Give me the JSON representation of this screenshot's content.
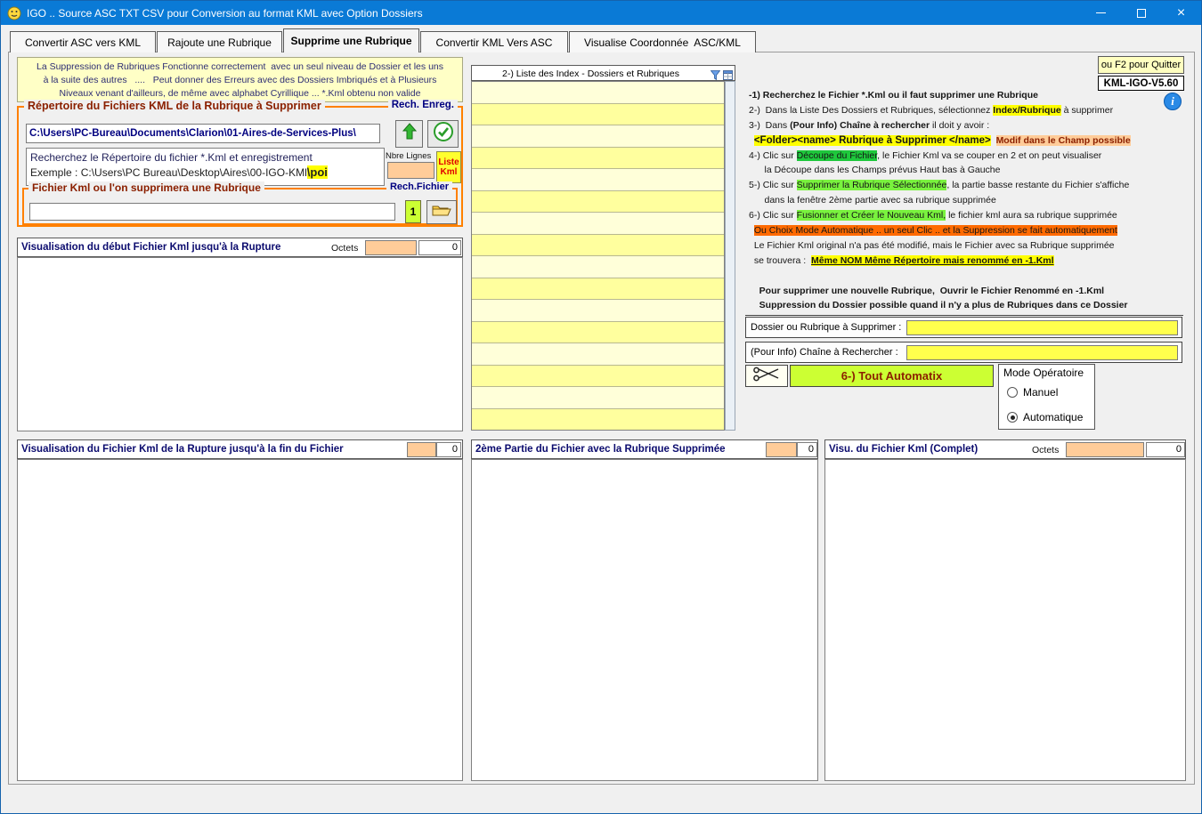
{
  "colors": {
    "titlebar": "#0a7ad6",
    "group_border": "#ff8000",
    "highlight_yellow": "#ffff00",
    "highlight_green": "#79f23e",
    "highlight_orange": "#ff6a00",
    "field_orange": "#ffcc99",
    "field_yellow": "#ffff4d",
    "auto_button": "#ccff33"
  },
  "window": {
    "title": "IGO .. Source ASC TXT CSV pour Conversion au format KML avec Option Dossiers"
  },
  "tabs": [
    {
      "label": "Convertir ASC vers KML",
      "active": false
    },
    {
      "label": "Rajoute une Rubrique",
      "active": false
    },
    {
      "label": "Supprime une Rubrique",
      "active": true
    },
    {
      "label": "Convertir KML Vers ASC",
      "active": false
    },
    {
      "label": "Visualise Coordonnée  ASC/KML",
      "active": false
    }
  ],
  "info_box": {
    "lines": [
      "La Suppression de Rubriques Fonctionne correctement  avec un seul niveau de Dossier et les uns",
      "à la suite des autres   ....   Peut donner des Erreurs avec des Dossiers Imbriqués et à Plusieurs",
      "Niveaux venant d'ailleurs, de même avec alphabet Cyrillique ... *.Kml obtenu non valide"
    ]
  },
  "rep_group": {
    "title": "Répertoire du Fichiers KML de la Rubrique à Supprimer",
    "rech_enreg": "Rech. Enreg.",
    "path": "C:\\Users\\PC-Bureau\\Documents\\Clarion\\01-Aires-de-Services-Plus\\",
    "hint1": "Recherchez le Répertoire du fichier *.Kml et enregistrement",
    "hint2a": "Exemple : C:\\Users\\PC Bureau\\Desktop\\Aires\\00-IGO-KMl",
    "hint2b": "\\poi",
    "nbre_label": "Nbre Lignes",
    "nbre_value": "",
    "liste_l1": "Liste",
    "liste_l2": "Kml"
  },
  "fich_group": {
    "title": "Fichier Kml ou l'on supprimera une Rubrique",
    "rech_label": "Rech.Fichier",
    "value": "",
    "count": "1"
  },
  "viz_top": {
    "title": "Visualisation du début Fichier Kml jusqu'à la Rupture",
    "octets_label": "Octets",
    "octets_value": "",
    "count": "0",
    "content": ""
  },
  "index_list": {
    "title": "2-) Liste des Index - Dossiers et Rubriques",
    "row_count": 16
  },
  "viz_bot": {
    "title": "Visualisation du Fichier Kml de la Rupture jusqu'à la fin du Fichier",
    "count": "0",
    "content": ""
  },
  "part2": {
    "title": "2ème Partie du Fichier avec la Rubrique Supprimée",
    "count": "0",
    "content": ""
  },
  "visu": {
    "title": "Visu. du Fichier Kml (Complet)",
    "octets_label": "Octets",
    "octets_value": "",
    "count": "0",
    "content": ""
  },
  "top_right": {
    "quit": "ou F2 pour Quitter",
    "version": "KML-IGO-V5.60"
  },
  "instructions": {
    "lines": [
      [
        {
          "t": "-1) Recherchez le Fichier *.Kml ou il faut supprimer une Rubrique",
          "s": "b"
        }
      ],
      [
        {
          "t": "2-)  Dans la Liste Des Dossiers et Rubriques, sélectionnez ",
          "s": "p"
        },
        {
          "t": "Index/Rubrique",
          "s": "hy"
        },
        {
          "t": " à supprimer",
          "s": "p"
        }
      ],
      [
        {
          "t": "3-)  Dans ",
          "s": "p"
        },
        {
          "t": "(Pour Info) Chaîne à rechercher",
          "s": "b"
        },
        {
          "t": " il doit y avoir :",
          "s": "p"
        }
      ],
      [
        {
          "t": "  ",
          "s": "p"
        },
        {
          "t": "<Folder><name> Rubrique à Supprimer </name>",
          "s": "hyb"
        },
        {
          "t": "  ",
          "s": "p"
        },
        {
          "t": "Modif dans le Champ possible",
          "s": "hp"
        }
      ],
      [
        {
          "t": "4-) Clic sur ",
          "s": "p"
        },
        {
          "t": "Découpe du Fichier",
          "s": "hg1"
        },
        {
          "t": ", le Fichier Kml va se couper en 2 et on peut visualiser",
          "s": "p"
        }
      ],
      [
        {
          "t": "      la Découpe dans les Champs prévus Haut bas à Gauche",
          "s": "p"
        }
      ],
      [
        {
          "t": "5-) Clic sur ",
          "s": "p"
        },
        {
          "t": "Supprimer la Rubrique Sélectionnée",
          "s": "hg2"
        },
        {
          "t": ", la partie basse restante du Fichier s'affiche",
          "s": "p"
        }
      ],
      [
        {
          "t": "      dans la fenêtre 2ème partie avec sa rubrique supprimée",
          "s": "p"
        }
      ],
      [
        {
          "t": "6-) Clic sur ",
          "s": "p"
        },
        {
          "t": "Fusionner et Créer le Nouveau Kml,",
          "s": "hg2"
        },
        {
          "t": " le fichier kml aura sa rubrique supprimée",
          "s": "p"
        }
      ],
      [
        {
          "t": "  ",
          "s": "p"
        },
        {
          "t": "Ou Choix Mode Automatique .. un seul Clic .. et la Suppression se fait automatiquement",
          "s": "ho"
        }
      ],
      [
        {
          "t": "  Le Fichier Kml original n'a pas été modifié, mais le Fichier avec sa Rubrique supprimée",
          "s": "p"
        }
      ],
      [
        {
          "t": "  se trouvera :  ",
          "s": "p"
        },
        {
          "t": "Même NOM Même Répertoire mais renommé en -1.Kml",
          "s": "hyu"
        }
      ],
      [
        {
          "t": " ",
          "s": "p"
        }
      ],
      [
        {
          "t": "    Pour supprimer une nouvelle Rubrique,  Ouvrir le Fichier Renommé en -1.Kml",
          "s": "b"
        }
      ],
      [
        {
          "t": "    Suppression du Dossier possible quand il n'y a plus de Rubriques dans ce Dossier",
          "s": "b"
        }
      ]
    ]
  },
  "fields": {
    "dossier_label": "Dossier ou Rubrique à Supprimer :",
    "dossier_value": "",
    "chaine_label": "(Pour Info) Chaîne à Rechercher :",
    "chaine_value": ""
  },
  "auto": {
    "label": "6-) Tout Automatix"
  },
  "mode": {
    "title": "Mode Opératoire",
    "options": [
      {
        "label": "Manuel",
        "selected": false
      },
      {
        "label": "Automatique",
        "selected": true
      }
    ]
  }
}
